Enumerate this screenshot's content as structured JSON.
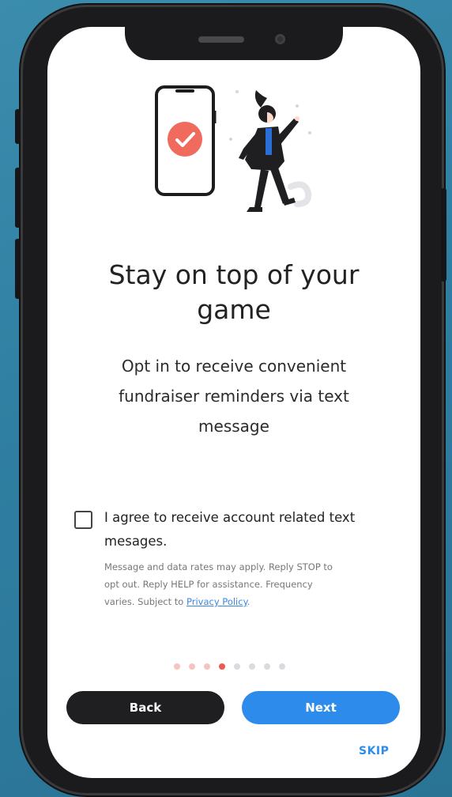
{
  "onboarding": {
    "headline_line1": "Stay on top of your",
    "headline_line2": "game",
    "subtext_line1": "Opt in to receive convenient",
    "subtext_line2": "fundraiser reminders via text",
    "subtext_line3": "message"
  },
  "consent": {
    "checked": false,
    "label_line1": "I agree to receive account related text",
    "label_line2": "mesages.",
    "fineprint_line1": "Message and data rates may apply. Reply STOP to",
    "fineprint_line2": "opt out. Reply HELP for assistance. Frequency",
    "fineprint_line3_prefix": "varies. Subject to ",
    "privacy_link": "Privacy Policy",
    "fineprint_line3_suffix": "."
  },
  "pagination": {
    "total": 8,
    "current": 4
  },
  "actions": {
    "back_label": "Back",
    "next_label": "Next",
    "skip_label": "SKIP"
  },
  "colors": {
    "accent": "#2d8ceb",
    "dark_button": "#1f1f21",
    "active_dot": "#ee5a52",
    "check_badge": "#f06a5e"
  }
}
